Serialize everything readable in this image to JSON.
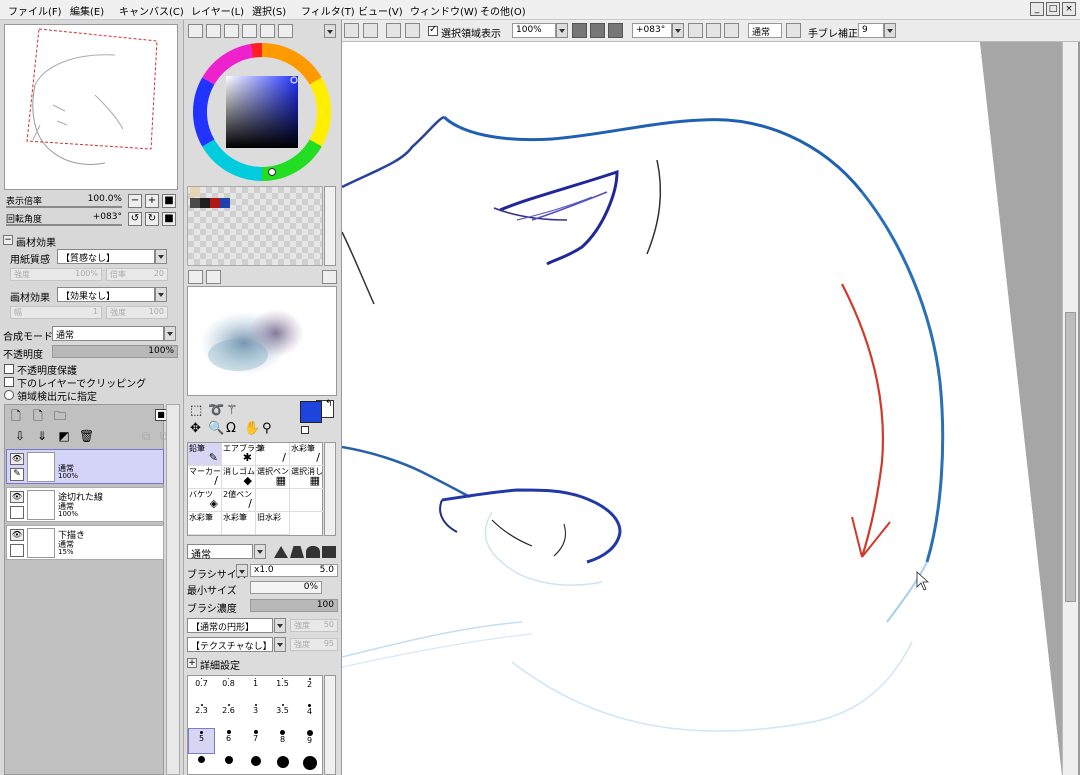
{
  "menu": [
    "ファイル(F)",
    "編集(E)",
    "キャンバス(C)",
    "レイヤー(L)",
    "選択(S)",
    "フィルタ(T)",
    "ビュー(V)",
    "ウィンドウ(W)",
    "その他(O)"
  ],
  "toolbar": {
    "selection_display_label": "選択領域表示",
    "zoom_value": "100%",
    "rotation_value": "+083°",
    "blend_label": "通常",
    "stabilizer_label": "手ブレ補正",
    "stabilizer_value": "9"
  },
  "navigator": {
    "zoom_label": "表示倍率",
    "zoom_value": "100.0%",
    "rotation_label": "回転角度",
    "rotation_value": "+083°"
  },
  "material": {
    "section_label": "画材効果",
    "paper_label": "用紙質感",
    "paper_value": "【質感なし】",
    "paper_strength_label": "強度",
    "paper_strength_value": "100%",
    "paper_scale_label": "倍率",
    "paper_scale_value": "20",
    "effect_label": "画材効果",
    "effect_value": "【効果なし】",
    "effect_width_label": "幅",
    "effect_width_value": "1",
    "effect_strength_label": "強度",
    "effect_strength_value": "100"
  },
  "layer_props": {
    "blend_mode_label": "合成モード",
    "blend_mode_value": "通常",
    "opacity_label": "不透明度",
    "opacity_value": "100%",
    "protect_opacity_label": "不透明度保護",
    "clip_label": "下のレイヤーでクリッピング",
    "detect_source_label": "領域検出元に指定"
  },
  "layers": [
    {
      "name": "",
      "mode": "通常",
      "opacity": "100%"
    },
    {
      "name": "途切れた線",
      "mode": "通常",
      "opacity": "100%"
    },
    {
      "name": "下描き",
      "mode": "通常",
      "opacity": "15%"
    }
  ],
  "brush": {
    "tools": [
      {
        "label": "鉛筆",
        "icon": "pencil-icon",
        "glyph": "✎"
      },
      {
        "label": "エアブラシ",
        "icon": "airbrush-icon",
        "glyph": "✱"
      },
      {
        "label": "筆",
        "icon": "brush-icon",
        "glyph": "/"
      },
      {
        "label": "水彩筆",
        "icon": "watercolor-icon",
        "glyph": "/"
      },
      {
        "label": "マーカー",
        "icon": "marker-icon",
        "glyph": "/"
      },
      {
        "label": "消しゴム",
        "icon": "eraser-icon",
        "glyph": "◆"
      },
      {
        "label": "選択ペン",
        "icon": "select-pen-icon",
        "glyph": "▦"
      },
      {
        "label": "選択消し",
        "icon": "select-erase-icon",
        "glyph": "▦"
      },
      {
        "label": "バケツ",
        "icon": "bucket-icon",
        "glyph": "◈"
      },
      {
        "label": "2値ペン",
        "icon": "binary-pen-icon",
        "glyph": "/"
      },
      {
        "label": "",
        "icon": "",
        "glyph": ""
      },
      {
        "label": "",
        "icon": "",
        "glyph": ""
      },
      {
        "label": "水彩筆",
        "icon": "watercolor2-icon",
        "glyph": ""
      },
      {
        "label": "水彩筆",
        "icon": "watercolor3-icon",
        "glyph": ""
      },
      {
        "label": "旧水彩",
        "icon": "old-watercolor-icon",
        "glyph": ""
      }
    ],
    "blend_value": "通常",
    "size_label": "ブラシサイズ",
    "size_multiplier": "x1.0",
    "size_value": "5.0",
    "min_size_label": "最小サイズ",
    "min_size_value": "0%",
    "density_label": "ブラシ濃度",
    "density_value": "100",
    "shape_value": "【通常の円形】",
    "shape_strength_label": "強度",
    "shape_strength_value": "50",
    "texture_value": "【テクスチャなし】",
    "texture_strength_label": "強度",
    "texture_strength_value": "95",
    "advanced_label": "詳細設定",
    "sizes": [
      {
        "v": "0.7",
        "d": 1
      },
      {
        "v": "0.8",
        "d": 1
      },
      {
        "v": "1",
        "d": 1
      },
      {
        "v": "1.5",
        "d": 1
      },
      {
        "v": "2",
        "d": 2
      },
      {
        "v": "2.3",
        "d": 2
      },
      {
        "v": "2.6",
        "d": 2
      },
      {
        "v": "3",
        "d": 2
      },
      {
        "v": "3.5",
        "d": 2
      },
      {
        "v": "4",
        "d": 3
      },
      {
        "v": "5",
        "d": 3
      },
      {
        "v": "6",
        "d": 4
      },
      {
        "v": "7",
        "d": 4
      },
      {
        "v": "8",
        "d": 5
      },
      {
        "v": "9",
        "d": 6
      },
      {
        "v": "",
        "d": 7
      },
      {
        "v": "",
        "d": 8
      },
      {
        "v": "",
        "d": 10
      },
      {
        "v": "",
        "d": 12
      },
      {
        "v": "",
        "d": 14
      }
    ],
    "selected_size_index": 10
  },
  "colors": {
    "primary": "#1e44e0",
    "secondary": "#ffffff",
    "swatches": [
      "#4a4a4a",
      "#1f1f1f",
      "#b01818",
      "#2040b0"
    ]
  }
}
